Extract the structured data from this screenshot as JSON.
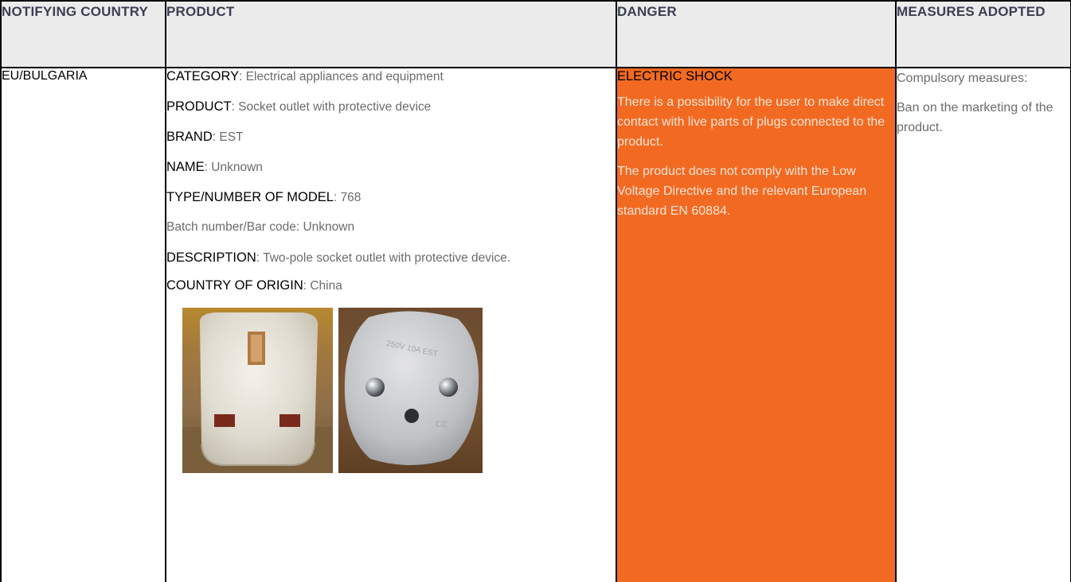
{
  "table": {
    "headers": {
      "country": "NOTIFYING COUNTRY",
      "product": "PRODUCT",
      "danger": "DANGER",
      "measures": "MEASURES ADOPTED"
    },
    "row": {
      "country": "EU/BULGARIA",
      "product": {
        "category_label": "CATEGORY",
        "category_value": ": Electrical appliances and equipment",
        "product_label": "PRODUCT",
        "product_value": ": Socket outlet with protective device",
        "brand_label": "BRAND",
        "brand_value": ": EST",
        "name_label": "NAME",
        "name_value": ": Unknown",
        "model_label": "TYPE/NUMBER OF MODEL",
        "model_value": ": 768",
        "batch": "Batch number/Bar code: Unknown",
        "description_label": "DESCRIPTION",
        "description_value": ": Two-pole socket outlet with protective device.",
        "origin_label": "COUNTRY OF ORIGIN",
        "origin_value": ": China",
        "photos": [
          {
            "alt": "UK socket adapter front",
            "stamp": ""
          },
          {
            "alt": "Schuko plug back",
            "stamp": "250V 10A EST CE"
          }
        ]
      },
      "danger": {
        "title": "ELECTRIC SHOCK",
        "paragraphs": [
          "There is a possibility for the user to make direct contact with live parts of plugs connected to the product.",
          "The product does not comply with the Low Voltage Directive and the relevant European standard EN 60884."
        ]
      },
      "measures": {
        "paragraphs": [
          "Compulsory measures:",
          "Ban on the marketing of the product."
        ]
      }
    }
  },
  "colors": {
    "header_bg": "#ebebeb",
    "header_text": "#3a3f52",
    "danger_bg": "#f26a22",
    "danger_text": "#ffe4d4",
    "body_text": "#6b6b6b"
  }
}
